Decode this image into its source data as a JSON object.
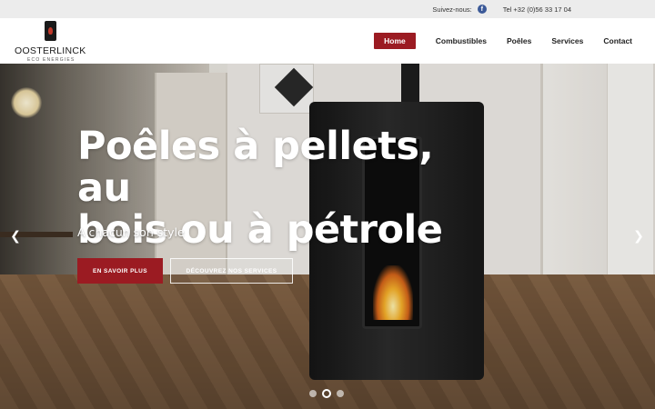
{
  "topbar": {
    "follow_label": "Suivez-nous:",
    "facebook_icon": "facebook-icon",
    "phone": "Tel +32 (0)56 33 17 04"
  },
  "logo": {
    "name": "OOSTERLINCK",
    "subtitle": "ECO ENERGIES"
  },
  "nav": {
    "items": [
      {
        "label": "Home",
        "active": true
      },
      {
        "label": "Combustibles",
        "active": false
      },
      {
        "label": "Poêles",
        "active": false
      },
      {
        "label": "Services",
        "active": false
      },
      {
        "label": "Contact",
        "active": false
      }
    ]
  },
  "hero": {
    "title_line1": "Poêles à pellets, au",
    "title_line2": "bois ou à pétrole",
    "subtitle": "A chacun son style",
    "primary_button": "EN SAVOIR PLUS",
    "secondary_button": "DÉCOUVREZ NOS SERVICES",
    "prev_icon": "chevron-left-icon",
    "next_icon": "chevron-right-icon",
    "slides": 3,
    "active_slide": 2
  },
  "colors": {
    "accent": "#9b1b22",
    "topbar_bg": "#ececec",
    "facebook": "#3b5998"
  }
}
